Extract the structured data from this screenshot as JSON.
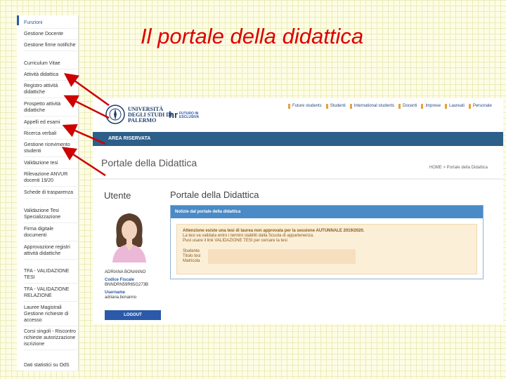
{
  "slide": {
    "title": "Il portale della didattica"
  },
  "menu": {
    "items": [
      "Funzioni",
      "Gestione Docente",
      "Gestione firme notifiche",
      "Curriculum Vitae",
      "Attività didattica",
      "Registro attività didattiche",
      "Prospetto attività didattiche",
      "Appelli ed esami",
      "Ricerca verbali",
      "Gestione ricevimento studenti",
      "Validazione tesi",
      "Rilevazione ANVUR docenti 19/20",
      "Schede di trasparenza",
      "Validazione Tesi Specializzazione",
      "Firma digitale documenti",
      "Approvazione registri attività didattiche",
      "TFA - VALIDAZIONE TESI",
      "TFA - VALIDAZIONE RELAZIONE",
      "Lauree Magistrali Gestione richieste di accesso",
      "Corsi singoli - Riscontro richieste autorizzazione iscrizione",
      "Dati statistici su OdS"
    ]
  },
  "portal": {
    "university_name": "UNIVERSITÀ DEGLI STUDI DI PALERMO",
    "hr_logo": "hr",
    "hr_subtitle": "FUTURO IN ESCLUSIVA",
    "top_nav": [
      "Future students",
      "Studenti",
      "International students",
      "Docenti",
      "Imprese",
      "Laureati",
      "Personale"
    ],
    "area": "AREA RISERVATA",
    "page_title": "Portale della Didattica",
    "breadcrumb": "HOME > Portale della Didattica",
    "utente_title": "Utente",
    "main_title": "Portale della Didattica",
    "user": {
      "name": "ADRIANA BONANNO",
      "cf_label": "Codice Fiscale",
      "cf_value": "BNNDRN59R65G273B",
      "username_label": "Username",
      "username_value": "adriana.bonanno",
      "logout": "LOGOUT"
    },
    "notice": {
      "header": "Notizie dal portale della didattica",
      "line1": "Attenzione esiste una tesi di laurea non approvata per la sessione AUTUNNALE 2019/2020.",
      "line2": "La tesi va validata entro i termini stabiliti dalla Scuola di appartenenza.",
      "line3": "Puoi usare il link VALIDAZIONE TESI per cercare la tesi",
      "fields": [
        "Studente",
        "Titolo tesi",
        "Matricola"
      ]
    }
  },
  "colors": {
    "title": "#dd0000",
    "arrow": "#cc0000",
    "portal_blue": "#2c5f8a",
    "notice_header": "#4a8ac6"
  }
}
